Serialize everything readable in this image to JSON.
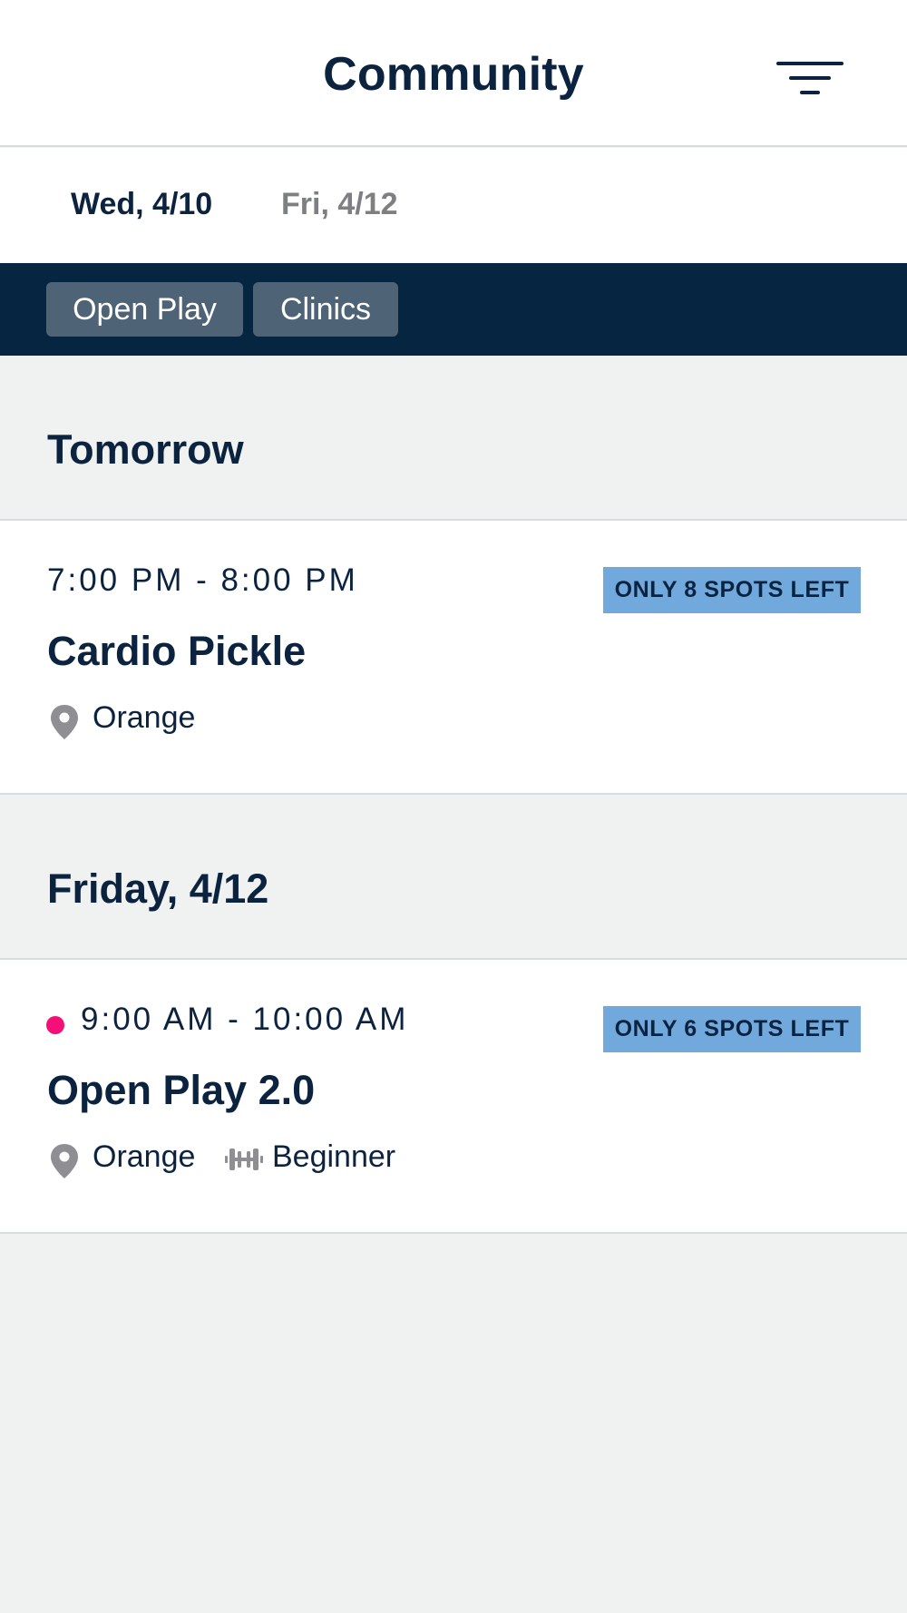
{
  "header": {
    "title": "Community",
    "filter_icon": "filter-lines-icon"
  },
  "dates": [
    {
      "label": "Wed, 4/10",
      "active": true
    },
    {
      "label": "Fri, 4/12",
      "active": false
    }
  ],
  "filters": [
    {
      "label": "Open Play"
    },
    {
      "label": "Clinics"
    }
  ],
  "sections": [
    {
      "title": "Tomorrow",
      "events": [
        {
          "time": "7:00 PM - 8:00 PM",
          "live": false,
          "title": "Cardio Pickle",
          "spots": "ONLY 8 SPOTS LEFT",
          "location": "Orange",
          "location_icon": "map-pin-icon"
        }
      ]
    },
    {
      "title": "Friday, 4/12",
      "events": [
        {
          "time": "9:00 AM - 10:00 AM",
          "live": true,
          "title": "Open Play 2.0",
          "spots": "ONLY 6 SPOTS LEFT",
          "location": "Orange",
          "location_icon": "map-pin-icon",
          "level": "Beginner",
          "level_icon": "dumbbell-icon"
        }
      ]
    }
  ],
  "colors": {
    "navy": "#0c2340",
    "chip_bar": "#062541",
    "chip": "#4f6377",
    "badge": "#72a9dd",
    "live_dot": "#f50f78",
    "background": "#f0f2f2"
  }
}
